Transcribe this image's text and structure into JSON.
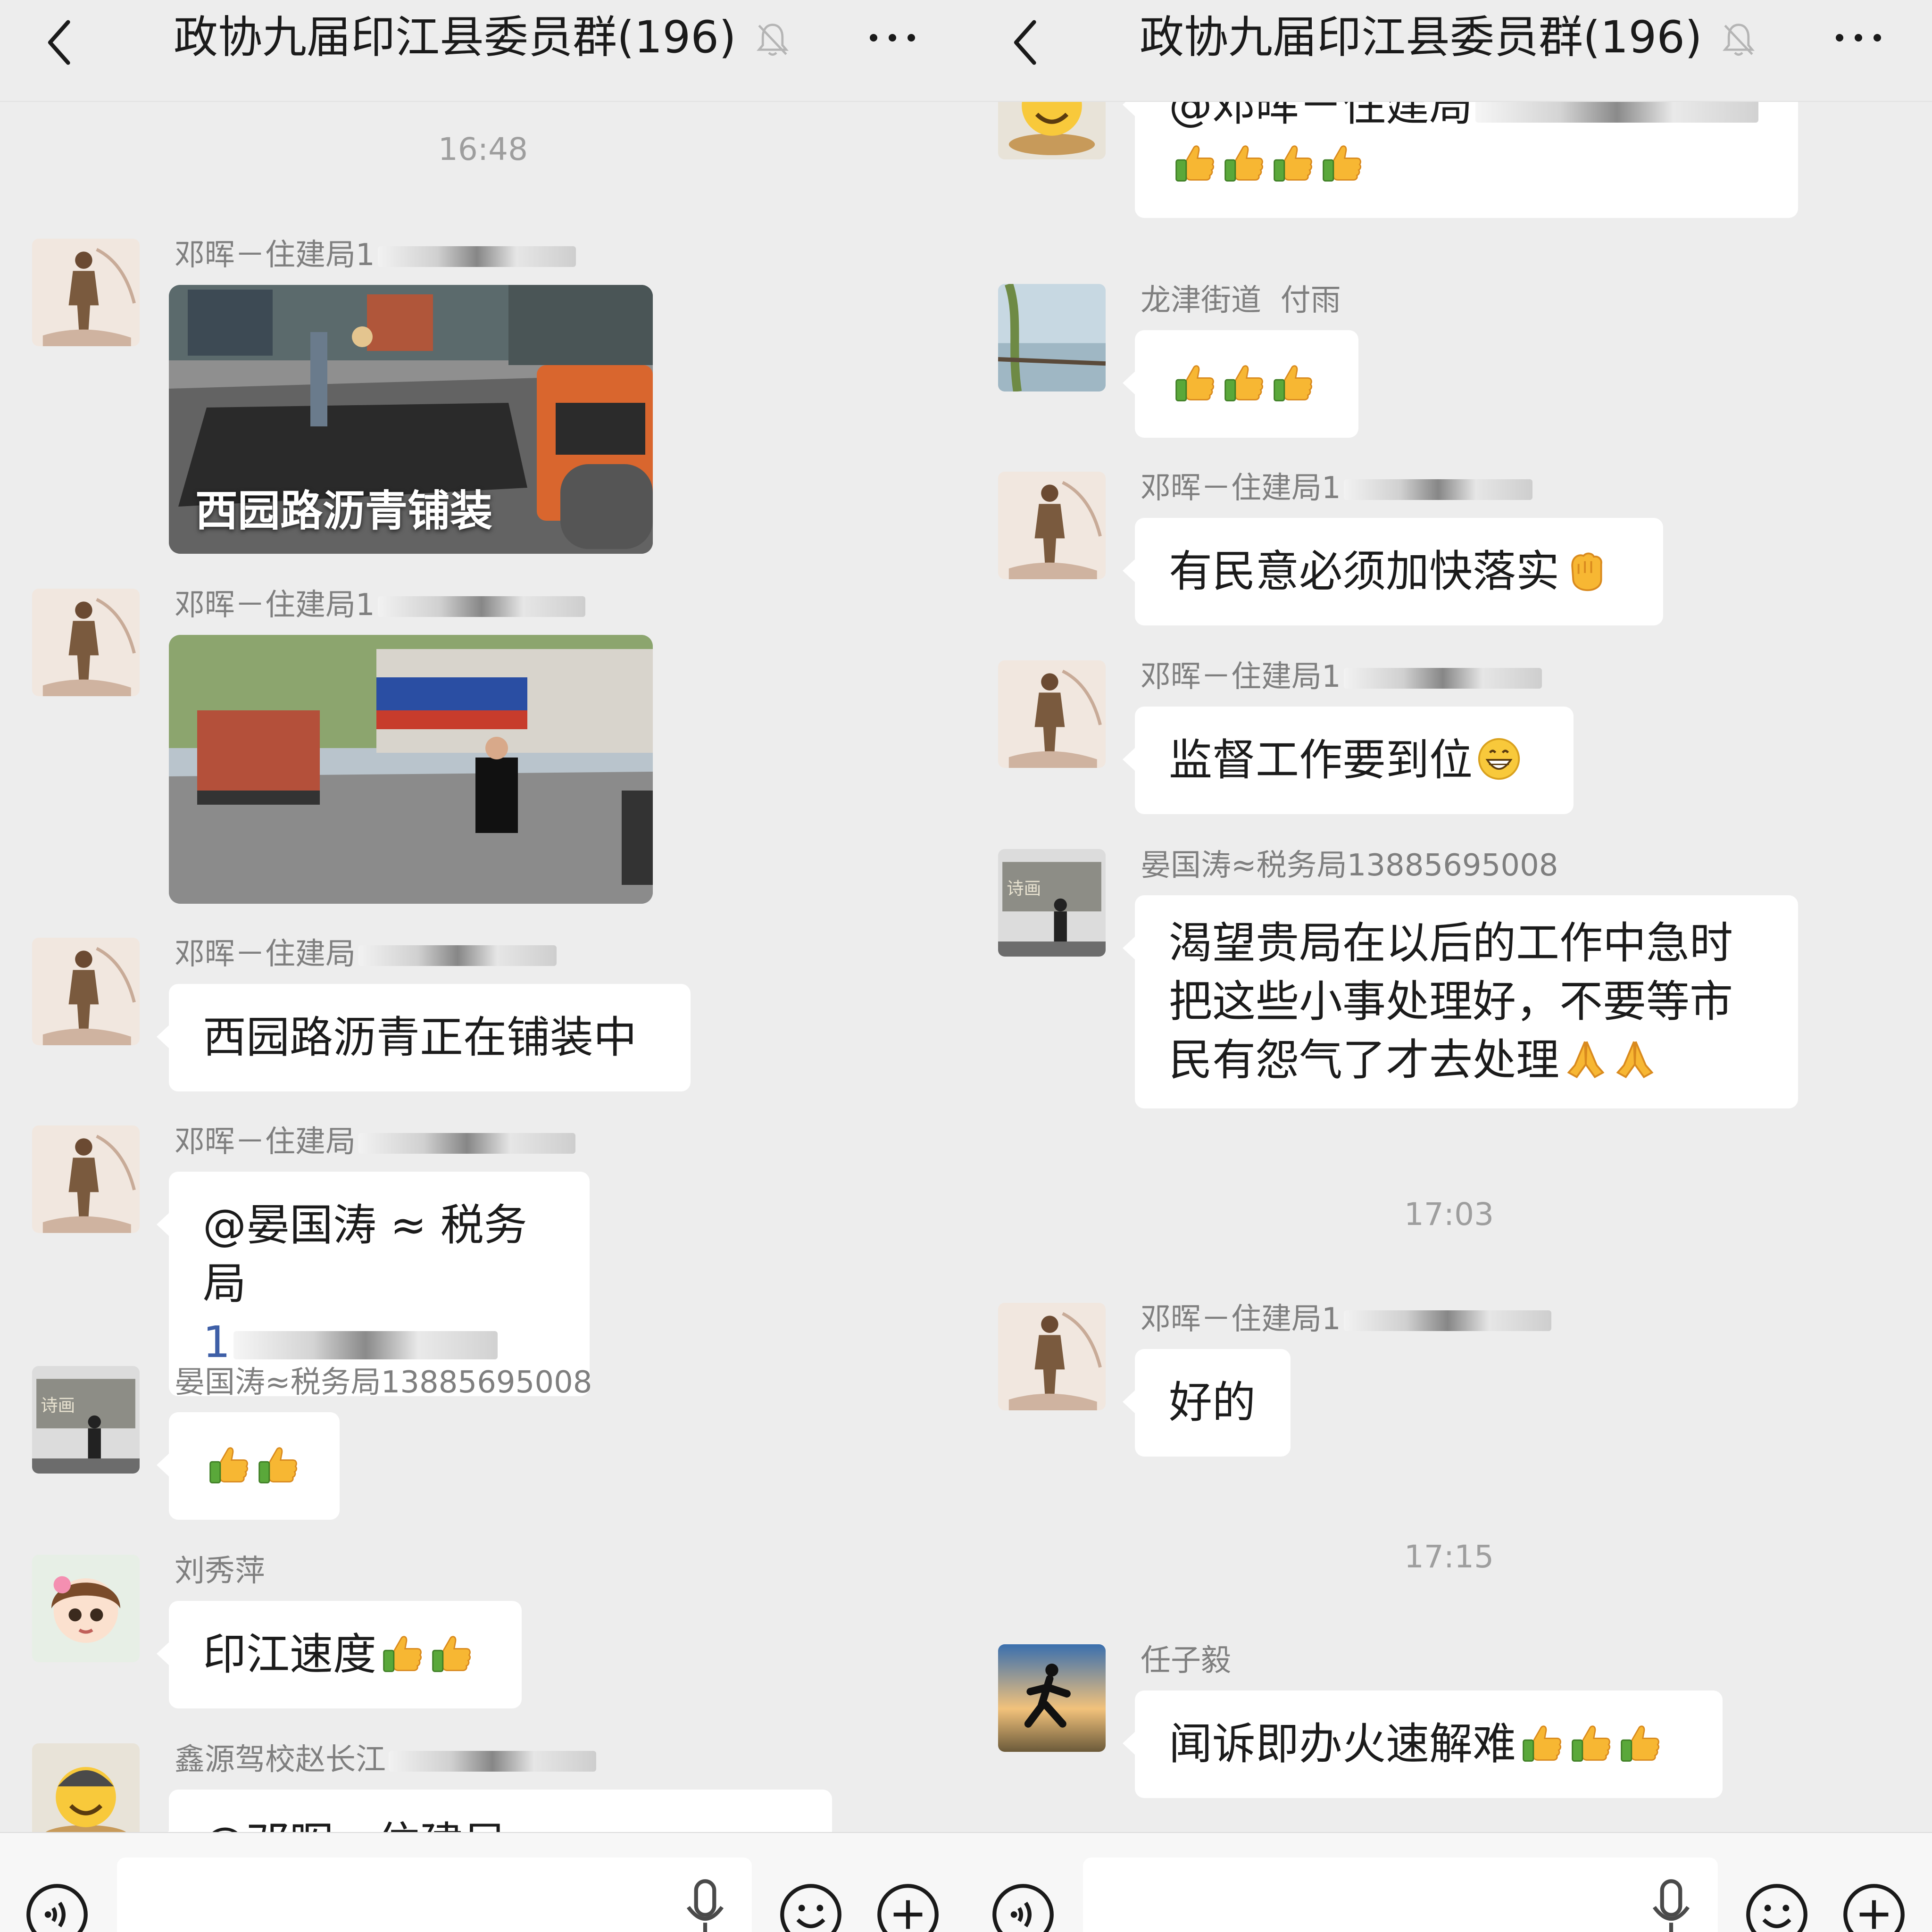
{
  "chat_title": "政协九届印江县委员群(196)",
  "left_pane": {
    "timestamp": "16:48",
    "messages": [
      {
        "sender": "邓晖－住建局1",
        "photo_caption": "西园路沥青铺装"
      },
      {
        "sender": "邓晖－住建局1"
      },
      {
        "sender": "邓晖－住建局",
        "text": "西园路沥青正在铺装中"
      },
      {
        "sender": "邓晖－住建局",
        "text_line1": "@晏国涛 ≈ 税务局",
        "text_line2": "1"
      },
      {
        "sender": "晏国涛≈税务局13885695008"
      },
      {
        "sender": "刘秀萍",
        "text": "印江速度"
      },
      {
        "sender": "鑫源驾校赵长江",
        "text": "@邓晖－住建局"
      }
    ]
  },
  "right_pane": {
    "messages": [
      {
        "text": "@邓晖－住建局"
      },
      {
        "sender": "龙津街道  付雨"
      },
      {
        "sender": "邓晖－住建局1",
        "text": "有民意必须加快落实"
      },
      {
        "sender": "邓晖－住建局1",
        "text": "监督工作要到位"
      },
      {
        "sender": "晏国涛≈税务局13885695008",
        "text_lines": [
          "渴望贵局在以后的工作中急时",
          "把这些小事处理好，不要等市",
          "民有怨气了才去处理"
        ]
      }
    ],
    "timestamp_1": "17:03",
    "reply": {
      "sender": "邓晖－住建局1",
      "text": "好的"
    },
    "timestamp_2": "17:15",
    "last": {
      "sender": "任子毅",
      "text": "闻诉即办火速解难"
    }
  },
  "icons": {
    "back": "chevron-left-icon",
    "mute": "bell-off-icon",
    "more": "more-dots-icon",
    "voice": "voice-input-icon",
    "mic": "microphone-icon",
    "emoji": "emoji-face-icon",
    "plus": "plus-circle-icon",
    "thumbs": "thumbs-up-emoji",
    "fist": "fist-emoji",
    "grin": "grin-emoji",
    "pray": "pray-hands-emoji"
  },
  "colors": {
    "background": "#ededed",
    "bubble": "#ffffff",
    "link": "#3e5fa7",
    "meta_text": "#9e9e9e"
  }
}
